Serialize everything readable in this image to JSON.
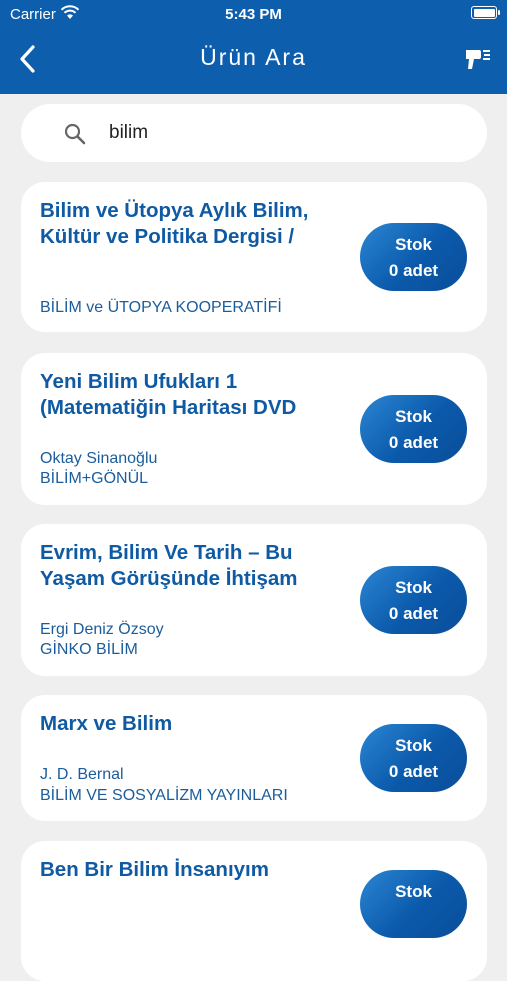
{
  "status": {
    "carrier": "Carrier",
    "time": "5:43 PM"
  },
  "nav": {
    "title": "Ürün Ara",
    "back_icon": "chevron-left-icon",
    "scan_icon": "barcode-scanner-icon"
  },
  "search": {
    "value": "bilim",
    "icon": "search-icon"
  },
  "colors": {
    "header": "#0d5fae",
    "accent": "#0f5aa3",
    "background": "#efefef"
  },
  "results": [
    {
      "title_line1": "Bilim ve Ütopya Aylık Bilim,",
      "title_line2": "Kültür ve Politika Dergisi /",
      "author": "",
      "publisher": "BİLİM ve ÜTOPYA KOOPERATİFİ",
      "stock_label": "Stok",
      "stock_value": "0 adet"
    },
    {
      "title_line1": "Yeni Bilim Ufukları 1",
      "title_line2": "(Matematiğin Haritası DVD",
      "author": "Oktay Sinanoğlu",
      "publisher": "BİLİM+GÖNÜL",
      "stock_label": "Stok",
      "stock_value": "0 adet"
    },
    {
      "title_line1": "Evrim, Bilim Ve Tarih – Bu",
      "title_line2": "Yaşam Görüşünde İhtişam",
      "author": "Ergi Deniz Özsoy",
      "publisher": "GİNKO BİLİM",
      "stock_label": "Stok",
      "stock_value": "0 adet"
    },
    {
      "title_line1": "Marx ve Bilim",
      "title_line2": "",
      "author": "J. D. Bernal",
      "publisher": "BİLİM VE SOSYALİZM YAYINLARI",
      "stock_label": "Stok",
      "stock_value": "0 adet"
    },
    {
      "title_line1": "Ben Bir Bilim İnsanıyım",
      "title_line2": "",
      "author": "",
      "publisher": "",
      "stock_label": "Stok",
      "stock_value": ""
    }
  ]
}
